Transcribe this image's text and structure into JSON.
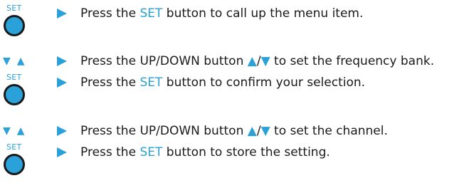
{
  "colors": {
    "accent": "#2aa1d8",
    "text": "#1a1a1a"
  },
  "icons": {
    "set_label": "SET",
    "set_knob": "set-knob-icon",
    "up_down": "up-down-icon",
    "bullet": "play-arrow-icon",
    "up_glyph": "▲",
    "down_glyph": "▼",
    "slash": "/"
  },
  "steps": [
    {
      "icon": "set",
      "pre": "Press the ",
      "hl": "SET",
      "post": " button to call up the menu item."
    },
    {
      "icon": "updown",
      "pre": "Press the UP/DOWN button ",
      "post": " to set the frequency bank."
    },
    {
      "icon": "set",
      "pre": "Press the ",
      "hl": "SET",
      "post": " button to confirm your selection."
    },
    {
      "icon": "updown",
      "pre": "Press the UP/DOWN button ",
      "post": " to set the channel."
    },
    {
      "icon": "set",
      "pre": "Press the ",
      "hl": "SET",
      "post": " button to store the setting."
    }
  ]
}
